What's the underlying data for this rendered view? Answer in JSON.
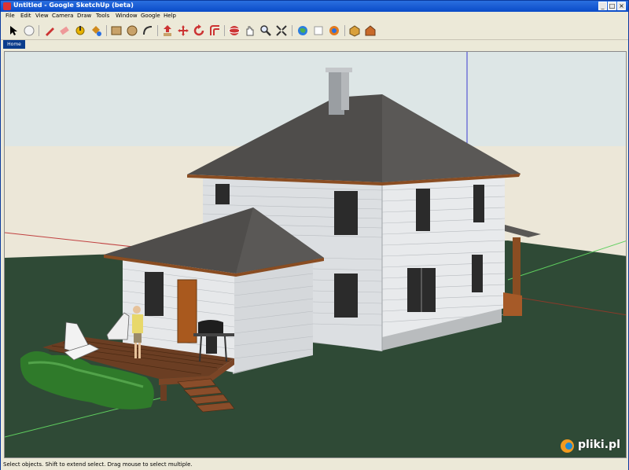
{
  "window": {
    "title": "Untitled - Google SketchUp (beta)",
    "controls": [
      "_",
      "□",
      "×"
    ]
  },
  "menu": [
    "File",
    "Edit",
    "View",
    "Camera",
    "Draw",
    "Tools",
    "Window",
    "Google",
    "Help"
  ],
  "toolbar": {
    "tools": [
      "select-arrow-icon",
      "eraser-sphere-icon",
      "pencil-line-icon",
      "eraser-icon",
      "tape-measure-icon",
      "paint-bucket-icon",
      "rectangle-icon",
      "circle-icon",
      "arc-icon",
      "push-pull-icon",
      "move-icon",
      "rotate-icon",
      "offset-icon",
      "orbit-icon",
      "pan-icon",
      "zoom-icon",
      "zoom-extents-icon",
      "google-earth-icon",
      "get-model-icon",
      "share-model-icon",
      "component-icon",
      "warehouse-icon"
    ]
  },
  "scenes": {
    "tab": "Home"
  },
  "status": {
    "text": "Select objects. Shift to extend select. Drag mouse to select multiple."
  },
  "watermark": {
    "text": "pliki.pl"
  },
  "colors": {
    "title_bar": "#0a4bc8",
    "sky": "#dde6e6",
    "ground": "#2f4a36",
    "roof": "#4f4d4b",
    "siding": "#d9dcdf",
    "trim": "#8a4d22"
  }
}
